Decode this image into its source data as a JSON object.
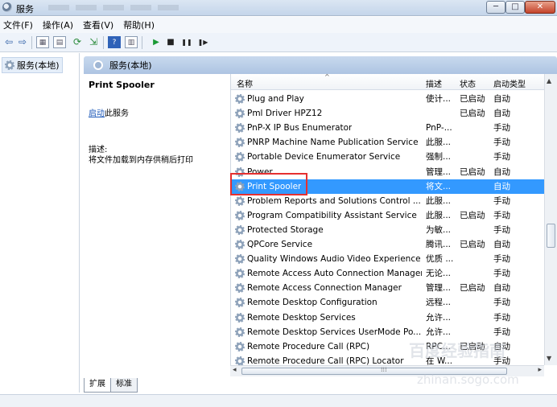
{
  "window": {
    "title": "服务",
    "min": "─",
    "max": "□",
    "close": "✕"
  },
  "menu": [
    "文件(F)",
    "操作(A)",
    "查看(V)",
    "帮助(H)"
  ],
  "toolbar": {
    "back": "⇦",
    "forward": "⇨",
    "play": "▶",
    "stop": "■",
    "pause": "❚❚",
    "restart": "❚▶"
  },
  "tree": {
    "root_label": "服务(本地)"
  },
  "main": {
    "header_title": "服务(本地)"
  },
  "details": {
    "service_name": "Print Spooler",
    "start_link": "启动",
    "start_suffix": "此服务",
    "desc_label": "描述:",
    "desc_text": "将文件加载到内存供稍后打印"
  },
  "table": {
    "columns": [
      "名称",
      "描述",
      "状态",
      "启动类型"
    ],
    "rows": [
      {
        "name": "Plug and Play",
        "desc": "使计...",
        "status": "已启动",
        "start": "自动"
      },
      {
        "name": "Pml Driver HPZ12",
        "desc": "",
        "status": "已启动",
        "start": "自动"
      },
      {
        "name": "PnP-X IP Bus Enumerator",
        "desc": "PnP-...",
        "status": "",
        "start": "手动"
      },
      {
        "name": "PNRP Machine Name Publication Service",
        "desc": "此服...",
        "status": "",
        "start": "手动"
      },
      {
        "name": "Portable Device Enumerator Service",
        "desc": "强制...",
        "status": "",
        "start": "手动"
      },
      {
        "name": "Power",
        "desc": "管理...",
        "status": "已启动",
        "start": "自动"
      },
      {
        "name": "Print Spooler",
        "desc": "将文...",
        "status": "",
        "start": "自动"
      },
      {
        "name": "Problem Reports and Solutions Control ...",
        "desc": "此服...",
        "status": "",
        "start": "手动"
      },
      {
        "name": "Program Compatibility Assistant Service",
        "desc": "此服...",
        "status": "已启动",
        "start": "手动"
      },
      {
        "name": "Protected Storage",
        "desc": "为敏...",
        "status": "",
        "start": "手动"
      },
      {
        "name": "QPCore Service",
        "desc": "腾讯...",
        "status": "已启动",
        "start": "自动"
      },
      {
        "name": "Quality Windows Audio Video Experience",
        "desc": "优质 ...",
        "status": "",
        "start": "手动"
      },
      {
        "name": "Remote Access Auto Connection Manager",
        "desc": "无论...",
        "status": "",
        "start": "手动"
      },
      {
        "name": "Remote Access Connection Manager",
        "desc": "管理...",
        "status": "已启动",
        "start": "自动"
      },
      {
        "name": "Remote Desktop Configuration",
        "desc": "远程...",
        "status": "",
        "start": "手动"
      },
      {
        "name": "Remote Desktop Services",
        "desc": "允许...",
        "status": "",
        "start": "手动"
      },
      {
        "name": "Remote Desktop Services UserMode Po...",
        "desc": "允许...",
        "status": "",
        "start": "手动"
      },
      {
        "name": "Remote Procedure Call (RPC)",
        "desc": "RPC...",
        "status": "已启动",
        "start": "自动"
      },
      {
        "name": "Remote Procedure Call (RPC) Locator",
        "desc": "在 W...",
        "status": "",
        "start": "手动"
      }
    ],
    "selected_index": 6
  },
  "tabs": [
    "扩展",
    "标准"
  ],
  "watermark": {
    "line1": "百度经验指南",
    "line2": "zhinan.sogo.com"
  },
  "colors": {
    "selection": "#3399ff",
    "highlight_box": "#e53030",
    "link": "#1a56b8"
  }
}
